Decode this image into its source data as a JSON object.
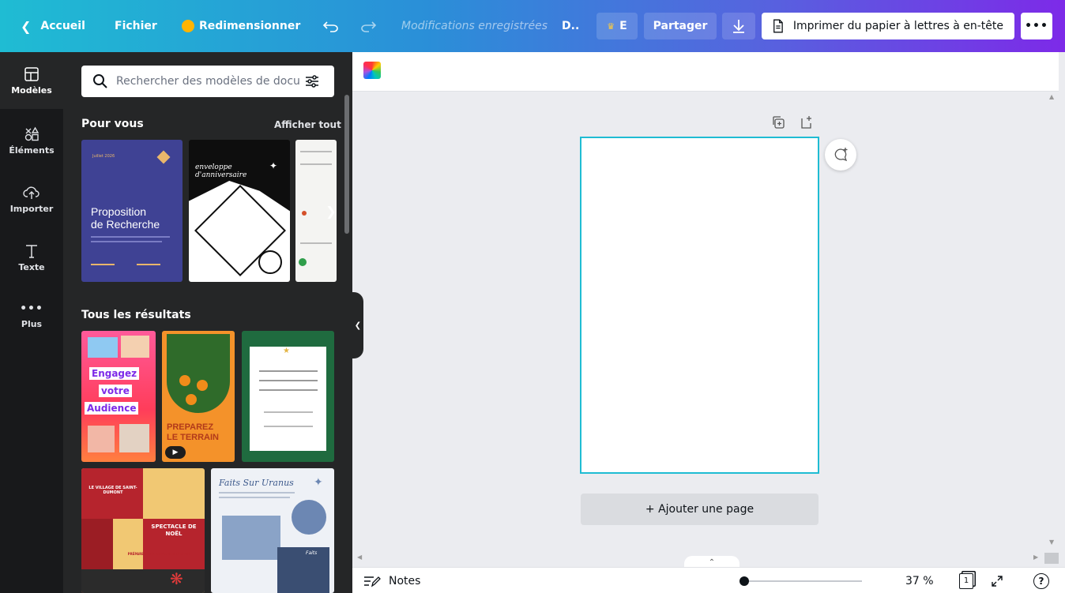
{
  "topbar": {
    "home_label": "Accueil",
    "file_label": "Fichier",
    "resize_label": "Redimensionner",
    "saved_status": "Modifications enregistrées",
    "title_short": "D..",
    "pro_label": "E",
    "share_label": "Partager",
    "print_label": "Imprimer du papier à lettres à en-tête",
    "more_label": "•••"
  },
  "rail": {
    "items": [
      {
        "label": "Modèles",
        "icon": "templates-icon"
      },
      {
        "label": "Éléments",
        "icon": "elements-icon"
      },
      {
        "label": "Importer",
        "icon": "upload-icon"
      },
      {
        "label": "Texte",
        "icon": "text-icon"
      },
      {
        "label": "Plus",
        "icon": "more-icon"
      }
    ]
  },
  "panel": {
    "search_placeholder": "Rechercher des modèles de docun",
    "for_you_title": "Pour vous",
    "see_all": "Afficher tout",
    "all_results_title": "Tous les résultats",
    "templates": {
      "research": {
        "date": "Juillet 2026",
        "title_line1": "Proposition",
        "title_line2": "de Recherche"
      },
      "birthday": {
        "title_line1": "enveloppe",
        "title_line2": "d'anniversaire"
      },
      "audience": {
        "line1": "Engagez",
        "line2": "votre",
        "line3": "Audience"
      },
      "terrain": {
        "line1": "PREPAREZ",
        "line2": "LE TERRAIN"
      },
      "noel": {
        "village": "LE VILLAGE DE SAINT-DUMONT",
        "show_line1": "SPECTACLE DE",
        "show_line2": "NOËL",
        "camera_note": "PRÉPAREZ VOS APPAREILS PHOTO!"
      },
      "uranus": {
        "title": "Faits Sur Uranus",
        "tag": "Faits"
      }
    }
  },
  "canvas": {
    "add_page_label": "+ Ajouter une page"
  },
  "bottombar": {
    "notes_label": "Notes",
    "zoom": "37 %",
    "page_count": "1",
    "help": "?"
  },
  "colors": {
    "accent": "#1fbcd3",
    "brand_purple": "#7d2ae8",
    "rail_bg": "#18191b",
    "panel_bg": "#252627"
  }
}
